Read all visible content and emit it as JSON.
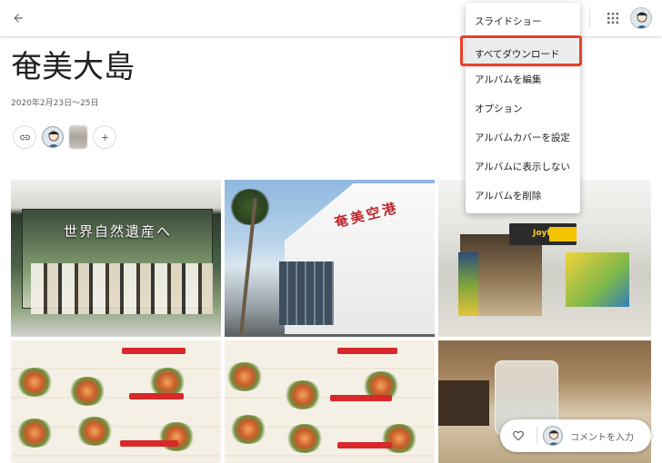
{
  "header": {
    "back_icon": "arrow-back-icon",
    "apps_icon": "apps-grid-icon",
    "account_avatar": "account-avatar"
  },
  "album": {
    "title": "奄美大島",
    "date_range": "2020年2月23日～25日"
  },
  "share": {
    "link_icon": "link-icon",
    "add_icon": "plus-icon"
  },
  "photos": {
    "p1_sign": "世界自然遺産へ",
    "p2_sign": "奄美空港",
    "p3_shop": "Joyfull"
  },
  "menu": {
    "items": [
      {
        "label": "スライドショー"
      },
      {
        "label": "すべてダウンロード",
        "highlighted": true
      },
      {
        "label": "アルバムを編集"
      },
      {
        "label": "オプション"
      },
      {
        "label": "アルバムカバーを設定"
      },
      {
        "label": "アルバムに表示しない"
      },
      {
        "label": "アルバムを削除"
      }
    ],
    "highlight_color": "#e8402c"
  },
  "comment_bar": {
    "heart_icon": "heart-outline-icon",
    "placeholder": "コメントを入力"
  }
}
